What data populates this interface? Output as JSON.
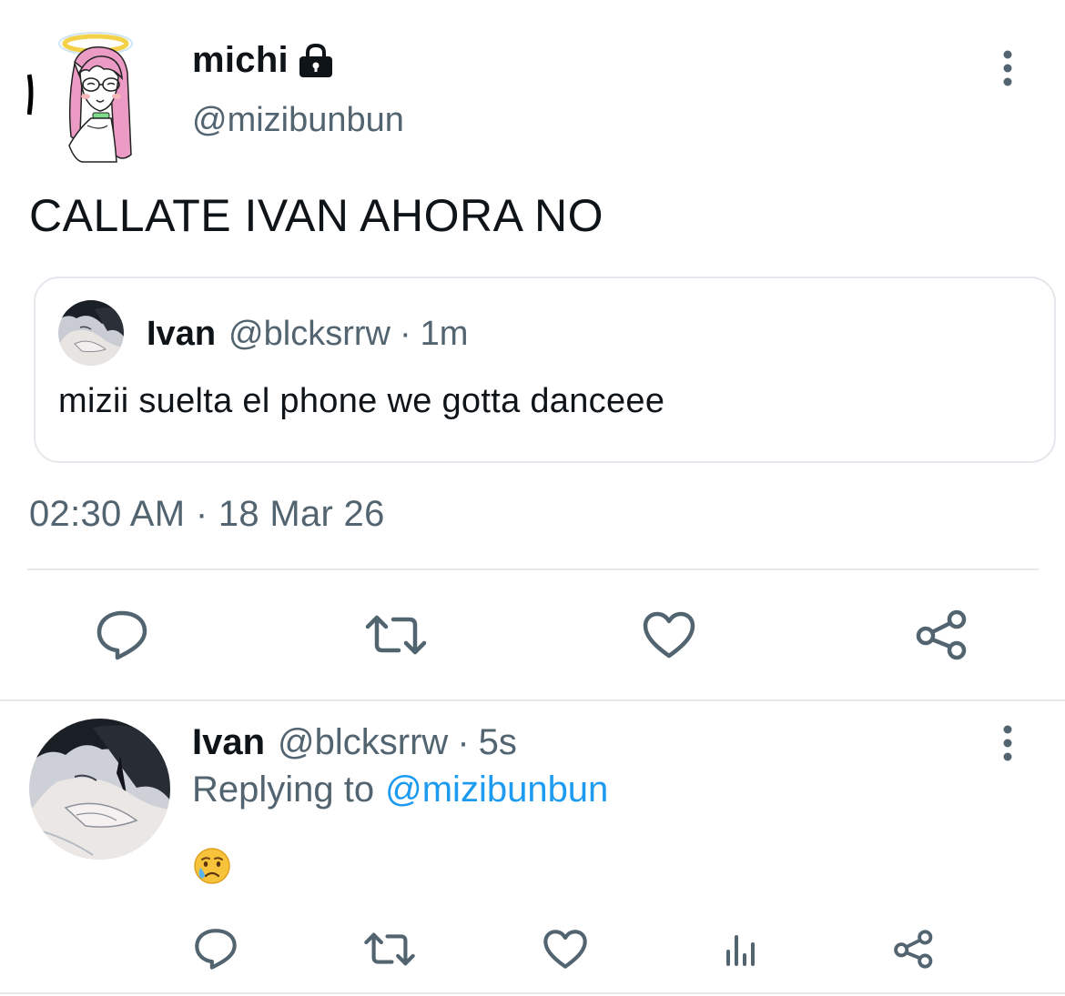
{
  "tweet": {
    "author_name": "michi",
    "author_handle": "@mizibunbun",
    "protected_icon": "lock-icon",
    "text": "CALLATE IVAN AHORA NO",
    "quote": {
      "author_name": "Ivan",
      "author_handle": "@blcksrrw",
      "separator": "·",
      "time": "1m",
      "text": "mizii suelta el phone we gotta danceee"
    },
    "timestamp": "02:30 AM · 18 Mar 26",
    "actions": [
      "reply-icon",
      "retweet-icon",
      "like-icon",
      "share-icon"
    ]
  },
  "reply": {
    "author_name": "Ivan",
    "author_handle": "@blcksrrw",
    "separator": "·",
    "time": "5s",
    "replying_prefix": "Replying to",
    "replying_handle": "@mizibunbun",
    "emoji_icon": "crying-face-icon",
    "actions": [
      "reply-icon",
      "retweet-icon",
      "like-icon",
      "views-icon",
      "share-icon"
    ]
  },
  "colors": {
    "text": "#0f1419",
    "secondary": "#536471",
    "link": "#1d9bf0",
    "icon": "#536471",
    "divider": "#e6e9ec"
  }
}
